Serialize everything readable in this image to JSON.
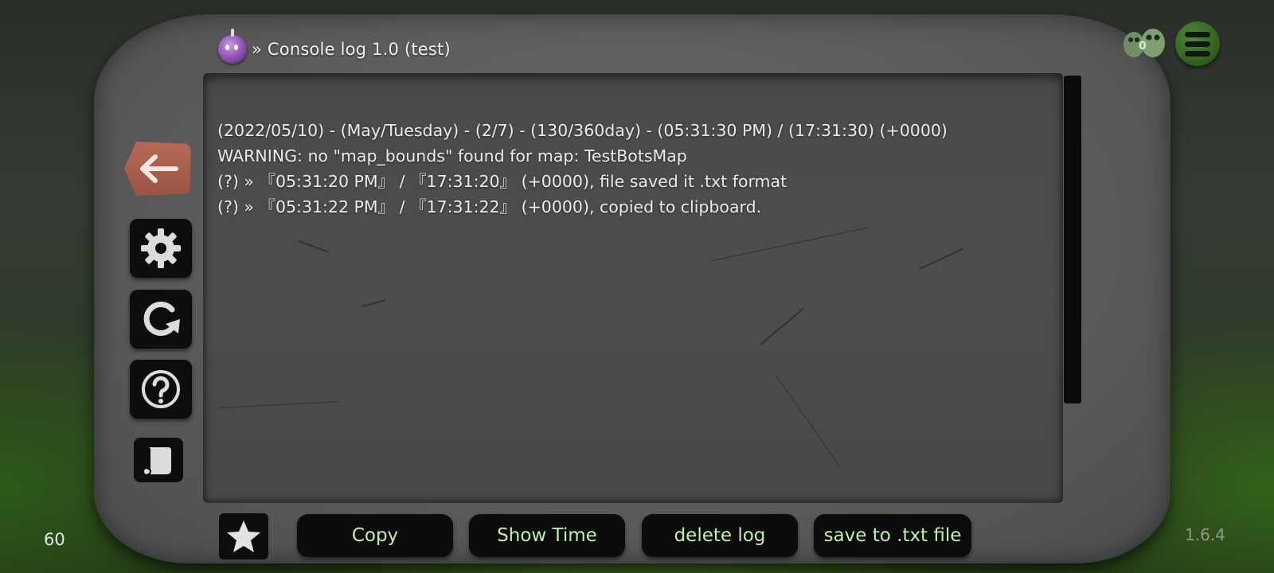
{
  "header": {
    "title": "» Console log 1.0 (test)"
  },
  "log": {
    "lines": [
      "(2022/05/10) - (May/Tuesday) - (2/7) - (130/360day) - (05:31:30 PM) / (17:31:30) (+0000)",
      "WARNING: no \"map_bounds\" found for map: TestBotsMap",
      "(?) »  『05:31:20 PM』 /  『17:31:20』 (+0000), file saved it .txt format",
      "(?) »  『05:31:22 PM』 /  『17:31:22』 (+0000), copied to clipboard."
    ]
  },
  "toolbar": {
    "copy_label": "Copy",
    "show_time_label": "Show Time",
    "delete_log_label": "delete log",
    "save_label": "save to .txt file"
  },
  "hud": {
    "fps": "60",
    "version": "1.6.4",
    "friends_count": "0"
  },
  "colors": {
    "button_text": "#c2f0a8",
    "back_button": "#a65c49",
    "menu_button": "#3b6e28"
  },
  "icons": {
    "back": "arrow-left-icon",
    "settings": "gear-icon",
    "refresh": "refresh-icon",
    "help": "question-icon",
    "scroll": "scroll-icon",
    "star": "star-icon",
    "friends": "friends-icon",
    "menu": "hamburger-menu-icon"
  }
}
